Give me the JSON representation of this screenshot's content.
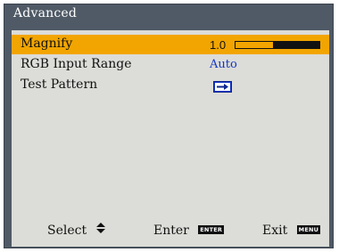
{
  "menu": {
    "title": "Advanced",
    "items": [
      {
        "label": "Magnify",
        "value": "1.0",
        "slider_level": 0.55,
        "selected": true
      },
      {
        "label": "RGB Input Range",
        "value": "Auto",
        "selected": false
      },
      {
        "label": "Test Pattern",
        "icon": "test-pattern-icon",
        "selected": false
      }
    ]
  },
  "footer": {
    "select_label": "Select",
    "select_icon": "up-down-arrows-icon",
    "enter_label": "Enter",
    "enter_key": "ENTER",
    "exit_label": "Exit",
    "exit_key": "MENU"
  },
  "colors": {
    "frame": "#4f5a66",
    "panel": "#dcdcd8",
    "highlight": "#f2a500",
    "value_text": "#1537c4"
  }
}
